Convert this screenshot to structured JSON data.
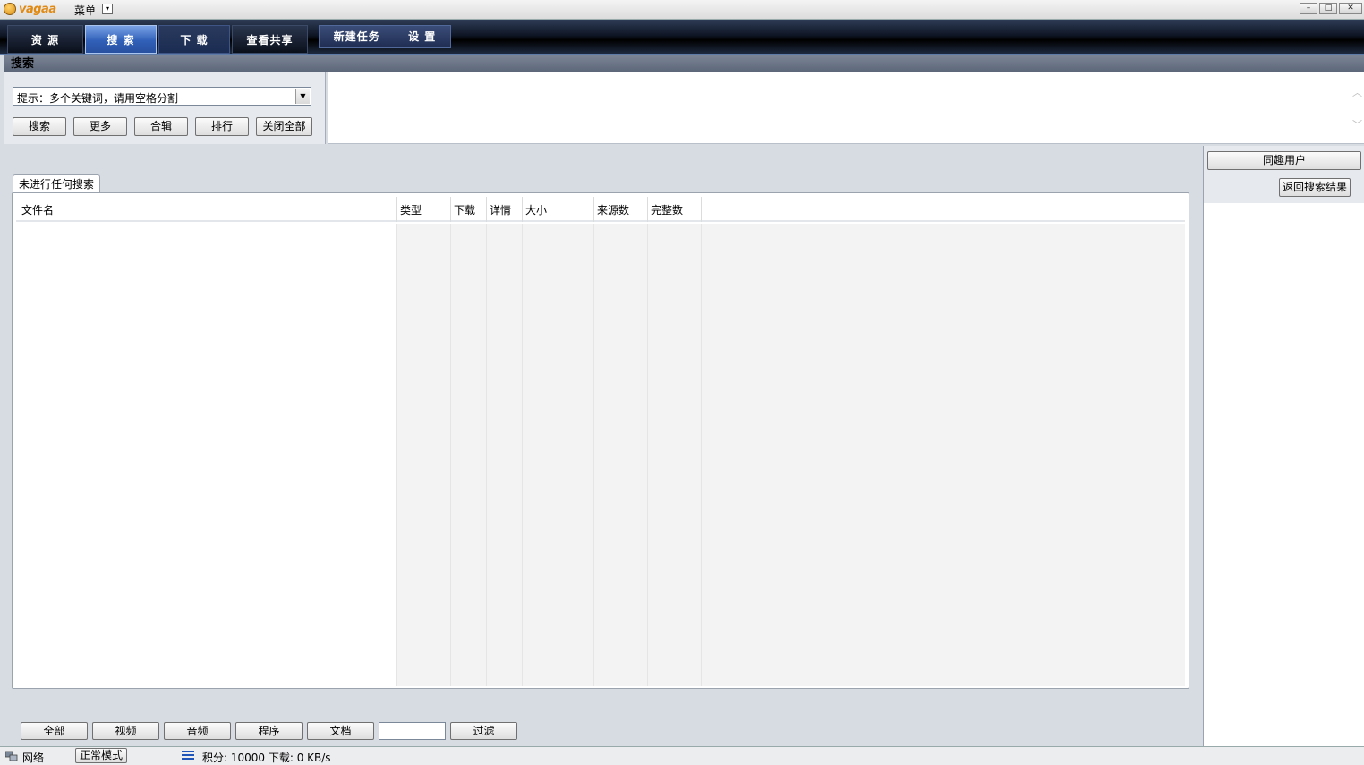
{
  "titlebar": {
    "logo_text": "vagaa",
    "menu_label": "菜单",
    "menu_arrow": "▾",
    "min_glyph": "–",
    "max_glyph": "□",
    "close_glyph": "✕"
  },
  "nav": {
    "tabs": [
      "资 源",
      "搜 索",
      "下 载",
      "查看共享"
    ],
    "active": "搜 索",
    "new_task": "新建任务",
    "settings": "设 置"
  },
  "section_title": "搜索",
  "search": {
    "combo_text": "提示：多个关键词，请用空格分割",
    "combo_arrow": "▼",
    "buttons": [
      "搜索",
      "更多",
      "合辑",
      "排行",
      "关闭全部"
    ]
  },
  "info_scroll": {
    "up": "︿",
    "down": "﹀"
  },
  "results": {
    "tab_label": "未进行任何搜索",
    "columns": [
      "文件名",
      "类型",
      "下载",
      "详情",
      "大小",
      "来源数",
      "完整数"
    ],
    "rows": []
  },
  "filters": {
    "buttons": [
      "全部",
      "视频",
      "音频",
      "程序",
      "文档"
    ],
    "input_value": "",
    "apply_label": "过滤"
  },
  "right_panel": {
    "users_button": "同趣用户",
    "back_button": "返回搜索结果"
  },
  "status": {
    "network_label": "网络",
    "mode_label": "正常模式",
    "score_text": "积分: 10000  下载: 0 KB/s"
  }
}
